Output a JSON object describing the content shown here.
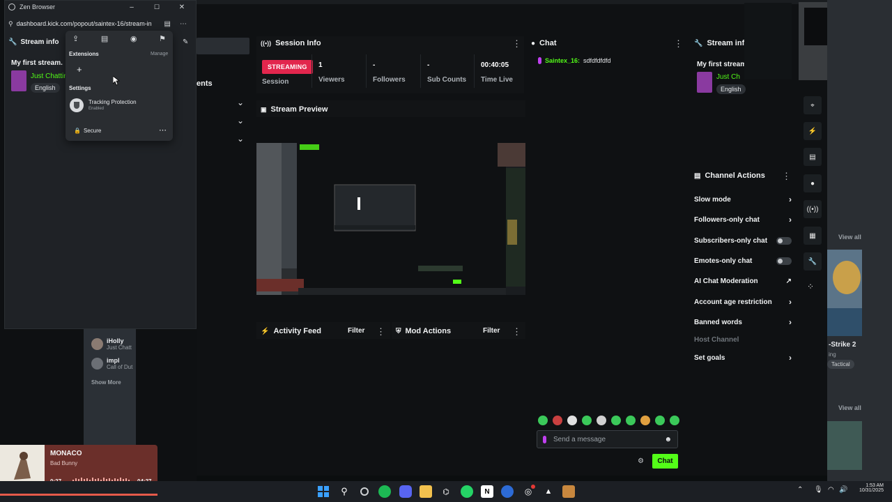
{
  "browser": {
    "title": "Zen Browser",
    "url": "dashboard.kick.com/popout/saintex-16/stream-in",
    "extensions_label": "Extensions",
    "manage_label": "Manage",
    "settings_label": "Settings",
    "tracking_title": "Tracking Protection",
    "tracking_status": "Enabled",
    "secure_label": "Secure"
  },
  "stream_info_left": {
    "title": "Stream info",
    "stream_title": "My first stream.",
    "category": "Just Chattin",
    "language": "English",
    "partial_heading": "ents"
  },
  "sidebar_list": {
    "items": [
      {
        "name": "iHolly",
        "sub": "Just Chatt"
      },
      {
        "name": "impl",
        "sub": "Call of Dut"
      }
    ],
    "show_more": "Show More"
  },
  "session": {
    "title": "Session Info",
    "badge": "STREAMING",
    "session_label": "Session",
    "stats": [
      {
        "value": "1",
        "label": "Viewers"
      },
      {
        "value": "-",
        "label": "Followers"
      },
      {
        "value": "-",
        "label": "Sub Counts"
      },
      {
        "value": "00:40:05",
        "label": "Time Live"
      }
    ]
  },
  "preview": {
    "title": "Stream Preview"
  },
  "activity": {
    "title": "Activity Feed",
    "filter": "Filter"
  },
  "mod": {
    "title": "Mod Actions",
    "filter": "Filter"
  },
  "chat": {
    "title": "Chat",
    "messages": [
      {
        "user": "Saintex_16:",
        "text": "sdfdfdfdfd"
      }
    ],
    "placeholder": "Send a message",
    "send_label": "Chat"
  },
  "stream_info_right": {
    "title": "Stream info",
    "stream_title": "My first stream",
    "category": "Just Ch",
    "language": "English"
  },
  "channel_actions": {
    "title": "Channel Actions",
    "items": [
      {
        "label": "Slow mode",
        "control": "chevron"
      },
      {
        "label": "Followers-only chat",
        "control": "chevron"
      },
      {
        "label": "Subscribers-only chat",
        "control": "toggle"
      },
      {
        "label": "Emotes-only chat",
        "control": "toggle"
      },
      {
        "label": "AI Chat Moderation",
        "control": "external"
      },
      {
        "label": "Account age restriction",
        "control": "chevron"
      },
      {
        "label": "Banned words",
        "control": "chevron"
      },
      {
        "label": "Host Channel",
        "control": "disabled"
      },
      {
        "label": "Set goals",
        "control": "chevron"
      }
    ]
  },
  "right_edge": {
    "view_all_1": "View all",
    "view_all_2": "View all",
    "game_title": "-Strike 2",
    "game_sub": "ing",
    "game_tag": "Tactical"
  },
  "music": {
    "track": "MONACO",
    "artist": "Bad Bunny",
    "elapsed": "0:27",
    "duration": "04:27"
  },
  "taskbar": {
    "time": "1:53 AM",
    "date": "10/31/2025"
  },
  "colors": {
    "kick_green": "#53fc18",
    "live_red": "#e2264d",
    "music_bg": "#6b2f2a"
  }
}
